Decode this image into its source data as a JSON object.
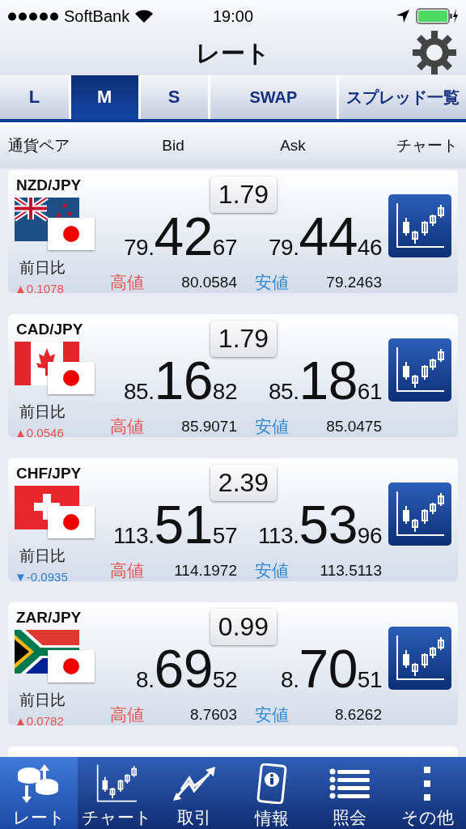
{
  "status_bar": {
    "carrier": "SoftBank",
    "time": "19:00"
  },
  "title": "レート",
  "tabs": [
    {
      "label": "L",
      "selected": false
    },
    {
      "label": "M",
      "selected": true
    },
    {
      "label": "S",
      "selected": false
    },
    {
      "label": "SWAP",
      "selected": false
    },
    {
      "label": "スプレッド一覧",
      "selected": false
    }
  ],
  "columns": [
    "通貨ペア",
    "Bid",
    "Ask",
    "チャート"
  ],
  "rates": [
    {
      "pair": "NZD/JPY",
      "flags": [
        {
          "kind": "nz"
        },
        {
          "kind": "jp"
        }
      ],
      "spread": "1.79",
      "bid": [
        "79.",
        "42",
        "67"
      ],
      "ask": [
        "79.",
        "44",
        "46"
      ],
      "change_label": "前日比",
      "change": {
        "kind": "up",
        "value": "▲0.1078"
      },
      "high_label": "高値",
      "high": "80.0584",
      "low_label": "安値",
      "low": "79.2463"
    },
    {
      "pair": "CAD/JPY",
      "flags": [
        {
          "kind": "ca"
        },
        {
          "kind": "jp"
        }
      ],
      "spread": "1.79",
      "bid": [
        "85.",
        "16",
        "82"
      ],
      "ask": [
        "85.",
        "18",
        "61"
      ],
      "change_label": "前日比",
      "change": {
        "kind": "up",
        "value": "▲0.0546"
      },
      "high_label": "高値",
      "high": "85.9071",
      "low_label": "安値",
      "low": "85.0475"
    },
    {
      "pair": "CHF/JPY",
      "flags": [
        {
          "kind": "ch"
        },
        {
          "kind": "jp"
        }
      ],
      "spread": "2.39",
      "bid": [
        "113.",
        "51",
        "57"
      ],
      "ask": [
        "113.",
        "53",
        "96"
      ],
      "change_label": "前日比",
      "change": {
        "kind": "down",
        "value": "▼-0.0935"
      },
      "high_label": "高値",
      "high": "114.1972",
      "low_label": "安値",
      "low": "113.5113"
    },
    {
      "pair": "ZAR/JPY",
      "flags": [
        {
          "kind": "za"
        },
        {
          "kind": "jp"
        }
      ],
      "spread": "0.99",
      "bid": [
        "8.",
        "69",
        "52"
      ],
      "ask": [
        "8.",
        "70",
        "51"
      ],
      "change_label": "前日比",
      "change": {
        "kind": "up",
        "value": "▲0.0782"
      },
      "high_label": "高値",
      "high": "8.7603",
      "low_label": "安値",
      "low": "8.6262"
    }
  ],
  "nav": [
    {
      "label": "レート",
      "selected": true
    },
    {
      "label": "チャート",
      "selected": false
    },
    {
      "label": "取引",
      "selected": false
    },
    {
      "label": "情報",
      "selected": false
    },
    {
      "label": "照会",
      "selected": false
    },
    {
      "label": "その他",
      "selected": false
    }
  ]
}
